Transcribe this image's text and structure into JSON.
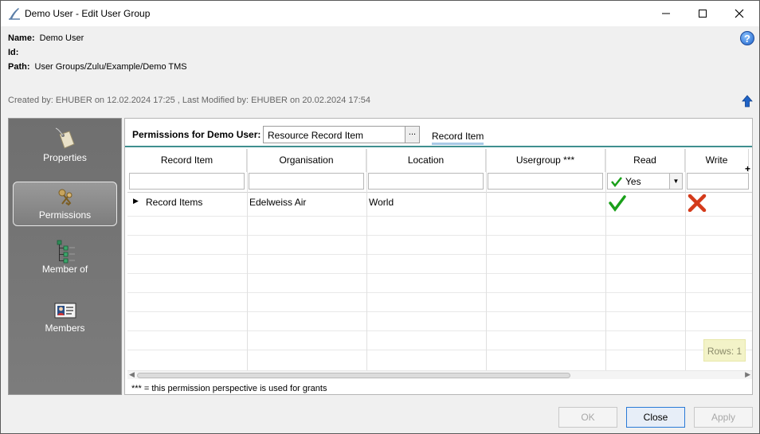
{
  "window": {
    "title": "Demo User - Edit User Group"
  },
  "info": {
    "name_label": "Name:",
    "name_value": "Demo User",
    "id_label": "Id:",
    "id_value": "",
    "path_label": "Path:",
    "path_value": "User Groups/Zulu/Example/Demo TMS",
    "created": "Created by: EHUBER on 12.02.2024 17:25 ,  Last Modified by: EHUBER on 20.02.2024 17:54"
  },
  "sidebar": {
    "items": [
      {
        "label": "Properties",
        "icon": "tag-icon",
        "selected": false
      },
      {
        "label": "Permissions",
        "icon": "keys-icon",
        "selected": true
      },
      {
        "label": "Member of",
        "icon": "tree-icon",
        "selected": false
      },
      {
        "label": "Members",
        "icon": "id-card-icon",
        "selected": false
      }
    ]
  },
  "permissions": {
    "label": "Permissions for Demo User:",
    "combo_value": "Resource Record Item",
    "combo_button": "...",
    "tab": "Record Item"
  },
  "grid": {
    "columns": [
      "Record Item",
      "Organisation",
      "Location",
      "Usergroup ***",
      "Read",
      "Write"
    ],
    "read_filter": "Yes",
    "plus": "+",
    "rows": [
      {
        "record_item": "Record Items",
        "organisation": "Edelweiss Air",
        "location": "World",
        "usergroup": "",
        "read": "yes",
        "write": "no"
      }
    ],
    "rows_count": "Rows: 1"
  },
  "footnote": "*** = this permission perspective is used for grants",
  "buttons": {
    "ok": "OK",
    "close": "Close",
    "apply": "Apply"
  },
  "colors": {
    "sidebar_bg": "#747474",
    "accent": "#3f8f8f",
    "check": "#1aa01a",
    "cross": "#d43a1a"
  }
}
